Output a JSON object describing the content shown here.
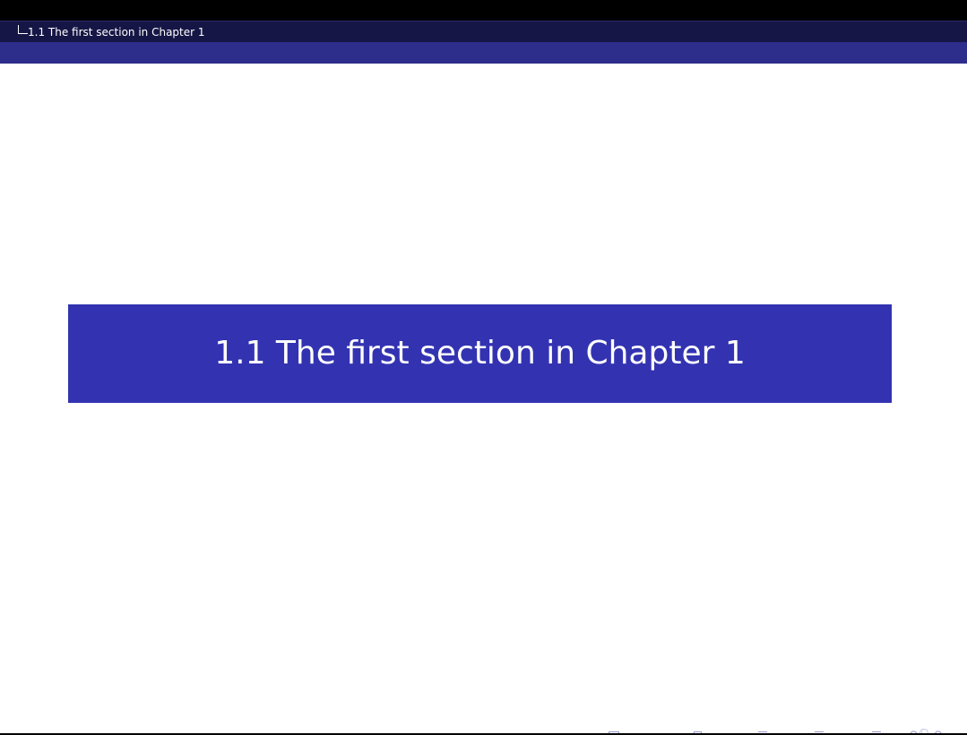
{
  "header": {
    "breadcrumb": "1.1 The first section in Chapter 1"
  },
  "slide": {
    "section_title": "1.1 The first section in Chapter 1"
  },
  "colors": {
    "top_bar": "#000000",
    "breadcrumb_bar": "#161646",
    "sub_bar": "#2d2d8c",
    "title_box": "#3333b2",
    "nav_symbols": "#9a9acf"
  },
  "navigation": {
    "icons": [
      "frame-prev-icon",
      "frame-icon",
      "frame-next-icon",
      "subsection-prev-icon",
      "subsection-icon",
      "subsection-next-icon",
      "section-prev-icon",
      "section-icon",
      "section-next-icon",
      "document-icon",
      "back-icon",
      "search-icon",
      "forward-icon"
    ]
  }
}
